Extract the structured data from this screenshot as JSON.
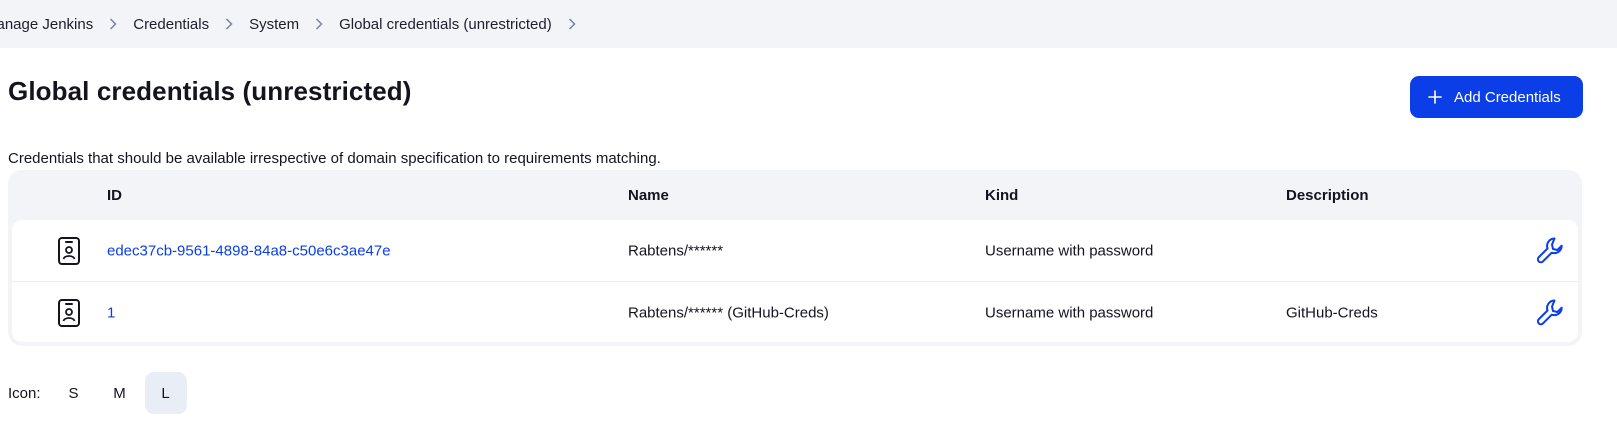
{
  "breadcrumb": {
    "items": [
      "Manage Jenkins",
      "Credentials",
      "System",
      "Global credentials (unrestricted)"
    ]
  },
  "header": {
    "title": "Global credentials (unrestricted)",
    "add_button_label": "Add Credentials",
    "add_button_icon": "plus-icon"
  },
  "subtitle": "Credentials that should be available irrespective of domain specification to requirements matching.",
  "table": {
    "columns": [
      "ID",
      "Name",
      "Kind",
      "Description"
    ],
    "rows": [
      {
        "icon": "credential-badge-icon",
        "id": "edec37cb-9561-4898-84a8-c50e6c3ae47e",
        "name": "Rabtens/******",
        "kind": "Username with password",
        "description": "",
        "action_icon": "wrench-icon"
      },
      {
        "icon": "credential-badge-icon",
        "id": "1",
        "name": "Rabtens/****** (GitHub-Creds)",
        "kind": "Username with password",
        "description": "GitHub-Creds",
        "action_icon": "wrench-icon"
      }
    ]
  },
  "icon_size": {
    "label": "Icon:",
    "options": [
      "S",
      "M",
      "L"
    ],
    "selected": "L"
  },
  "colors": {
    "accent": "#0b3ee6",
    "breadcrumb_bg": "#f2f4f8",
    "table_bg": "#f2f4f8",
    "selected_size_bg": "#e9edf6"
  }
}
